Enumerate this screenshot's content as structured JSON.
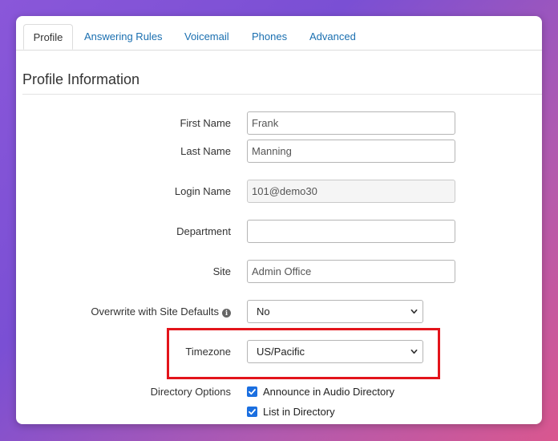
{
  "tabs": [
    {
      "label": "Profile",
      "active": true
    },
    {
      "label": "Answering Rules",
      "active": false
    },
    {
      "label": "Voicemail",
      "active": false
    },
    {
      "label": "Phones",
      "active": false
    },
    {
      "label": "Advanced",
      "active": false
    }
  ],
  "section": {
    "title": "Profile Information"
  },
  "form": {
    "first_name": {
      "label": "First Name",
      "value": "Frank"
    },
    "last_name": {
      "label": "Last Name",
      "value": "Manning"
    },
    "login_name": {
      "label": "Login Name",
      "value": "101@demo30"
    },
    "department": {
      "label": "Department",
      "value": ""
    },
    "site": {
      "label": "Site",
      "value": "Admin Office"
    },
    "overwrite": {
      "label": "Overwrite with Site Defaults",
      "value": "No",
      "icon": "info-icon"
    },
    "timezone": {
      "label": "Timezone",
      "value": "US/Pacific"
    },
    "directory": {
      "label": "Directory Options",
      "options": [
        {
          "label": "Announce in Audio Directory",
          "checked": true
        },
        {
          "label": "List in Directory",
          "checked": true
        }
      ]
    }
  },
  "colors": {
    "link": "#1a6fb0",
    "highlight": "#e3141b",
    "checkbox": "#1b6fe0"
  }
}
